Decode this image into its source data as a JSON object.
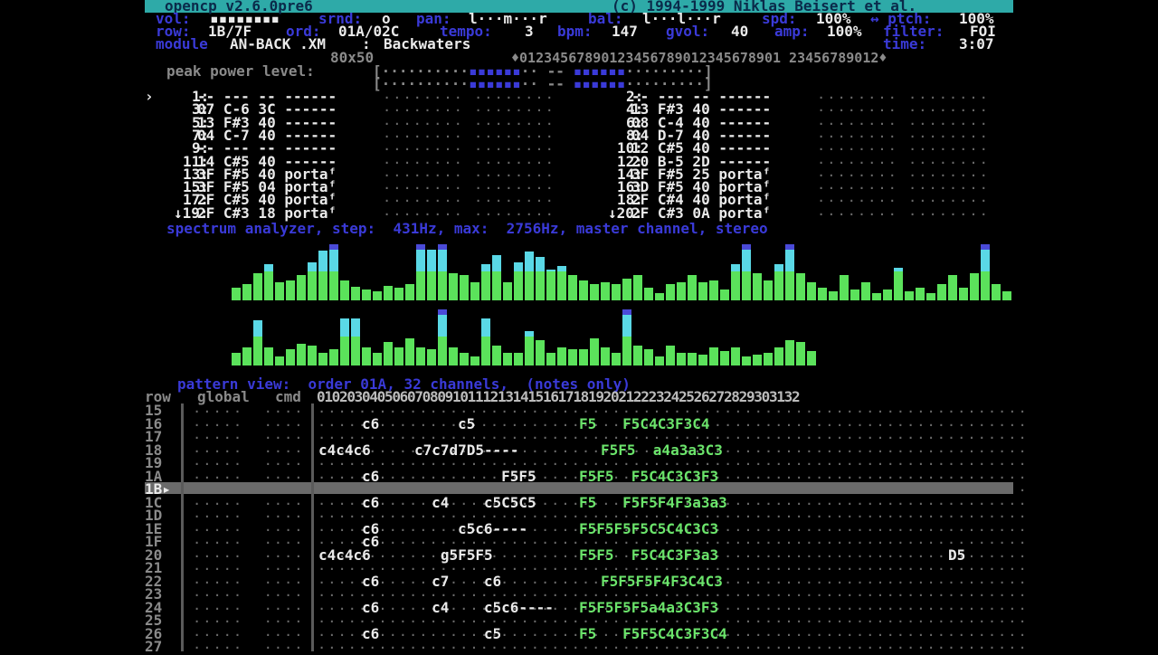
{
  "header": {
    "title": "opencp v2.6.0pre6",
    "copyright": "(c) 1994-1999 Niklas Beisert et al.",
    "vol_label": "vol:",
    "vol_bar": "▪▪▪▪▪▪▪▪",
    "srnd_label": "srnd:",
    "srnd_value": "o",
    "pan_label": "pan:",
    "pan_value": "l···m···r",
    "bal_label": "bal:",
    "bal_value": "l···l···r",
    "spd_label": "spd:",
    "spd_value": "100%",
    "ptch_label": "↔ ptch:",
    "ptch_value": "100%",
    "row_label": "row:",
    "row_value": "1B/7F",
    "ord_label": "ord:",
    "ord_value": "01A/02C",
    "tempo_label": "tempo:",
    "tempo_value": "3",
    "bpm_label": "bpm:",
    "bpm_value": "147",
    "gvol_label": "gvol:",
    "gvol_value": "40",
    "amp_label": "amp:",
    "amp_value": "100%",
    "filter_label": "filter:",
    "filter_value": "FOI",
    "module_label": "module",
    "module_file": "AN-BACK .XM",
    "module_sep": ":",
    "module_name": "Backwaters",
    "time_label": "time:",
    "time_value": "3:07"
  },
  "peak": {
    "label": "peak power level:",
    "resolution": "80x50",
    "ruler": "♦01234567890123456789012345678901 23456789012♦"
  },
  "channels": [
    {
      "n": "1:",
      "txt": "-- --- -- ------",
      "cursor": true
    },
    {
      "n": "2:",
      "txt": "-- --- -- ------"
    },
    {
      "n": "3:",
      "txt": "07 C-6 3C ------"
    },
    {
      "n": "4:",
      "txt": "13 F#3 40 ------"
    },
    {
      "n": "5:",
      "txt": "13 F#3 40 ------"
    },
    {
      "n": "6:",
      "txt": "08 C-4 40 ------"
    },
    {
      "n": "7:",
      "txt": "04 C-7 40 ------"
    },
    {
      "n": "8:",
      "txt": "04 D-7 40 ------"
    },
    {
      "n": "9:",
      "txt": "-- --- -- ------"
    },
    {
      "n": "10:",
      "txt": "12 C#5 40 ------"
    },
    {
      "n": "11:",
      "txt": "14 C#5 40 ------"
    },
    {
      "n": "12:",
      "txt": "20 B-5 2D ------"
    },
    {
      "n": "13:",
      "txt": "3F F#5 40 portaᶠ"
    },
    {
      "n": "14:",
      "txt": "3F F#5 25 portaᶠ"
    },
    {
      "n": "15:",
      "txt": "3F F#5 04 portaᶠ"
    },
    {
      "n": "16:",
      "txt": "3D F#5 40 portaᶠ"
    },
    {
      "n": "17:",
      "txt": "2F C#5 40 portaᶠ"
    },
    {
      "n": "18:",
      "txt": "2F C#4 40 portaᶠ"
    },
    {
      "n": "↓19:",
      "txt": "2F C#3 18 portaᶠ"
    },
    {
      "n": "↓20:",
      "txt": "2F C#3 0A portaᶠ"
    }
  ],
  "spectrum": {
    "label": "spectrum analyzer, step:  431Hz, max:  2756Hz, master channel, stereo",
    "left": [
      14,
      18,
      30,
      40,
      20,
      22,
      28,
      42,
      55,
      62,
      22,
      15,
      12,
      10,
      16,
      14,
      18,
      60,
      56,
      62,
      30,
      28,
      20,
      40,
      50,
      20,
      42,
      54,
      48,
      34,
      38,
      28,
      22,
      18,
      20,
      18,
      24,
      28,
      14,
      8,
      18,
      20,
      28,
      20,
      22,
      12,
      40,
      62,
      30,
      22,
      40,
      64,
      30,
      20,
      14,
      10,
      28,
      12,
      20,
      8,
      12,
      36,
      10,
      14,
      8,
      18,
      28,
      14,
      30,
      62,
      18,
      10
    ],
    "right": [
      14,
      20,
      50,
      20,
      10,
      18,
      24,
      22,
      14,
      18,
      52,
      52,
      20,
      14,
      26,
      20,
      30,
      20,
      18,
      64,
      20,
      14,
      10,
      52,
      22,
      14,
      14,
      38,
      28,
      14,
      20,
      18,
      18,
      30,
      20,
      14,
      64,
      22,
      18,
      10,
      22,
      14,
      14,
      12,
      20,
      16,
      20,
      10,
      12,
      14,
      20,
      28,
      26,
      16
    ]
  },
  "pattern": {
    "label": "pattern view:  order 01A, 32 channels,  (notes only)",
    "header_row": "row",
    "header_global": "global",
    "header_cmd": "cmd",
    "channel_ruler": "0102030405060708091011121314151617181920212223242526272829303132",
    "rows": [
      {
        "r": "15",
        "w": "",
        "g": ""
      },
      {
        "r": "16",
        "w": "c6         c5",
        "g": "F5   F5C4C3F3C4"
      },
      {
        "r": "17",
        "w": "",
        "g": ""
      },
      {
        "r": "18",
        "w": "c4c4c6     c7c7d7D5----",
        "g": "F5F5  a4a3a3C3"
      },
      {
        "r": "19",
        "w": "",
        "g": ""
      },
      {
        "r": "1A",
        "w": "c6              F5F5",
        "g": "F5F5  F5C4C3C3F3"
      },
      {
        "r": "1B",
        "w": "",
        "g": "",
        "current": true
      },
      {
        "r": "1C",
        "w": "c6      c4    c5C5C5",
        "g": "F5   F5F5F4F3a3a3"
      },
      {
        "r": "1D",
        "w": "",
        "g": ""
      },
      {
        "r": "1E",
        "w": "c6         c5c6----",
        "g": "F5F5F5F5C5C4C3C3"
      },
      {
        "r": "1F",
        "w": "c6",
        "g": ""
      },
      {
        "r": "20",
        "w": "c4c4c6        g5F5F5",
        "g": "F5F5  F5C4C3F3a3",
        "extra": "D5"
      },
      {
        "r": "21",
        "w": "",
        "g": ""
      },
      {
        "r": "22",
        "w": "c6      c7    c6",
        "g": "F5F5F5F4F3C4C3"
      },
      {
        "r": "23",
        "w": "",
        "g": ""
      },
      {
        "r": "24",
        "w": "c6      c4    c5c6----",
        "g": "F5F5F5F5a4a3C3F3"
      },
      {
        "r": "25",
        "w": "",
        "g": ""
      },
      {
        "r": "26",
        "w": "c6            c5",
        "g": "F5   F5F5C4C3F3C4"
      },
      {
        "r": "27",
        "w": "",
        "g": ""
      }
    ]
  }
}
